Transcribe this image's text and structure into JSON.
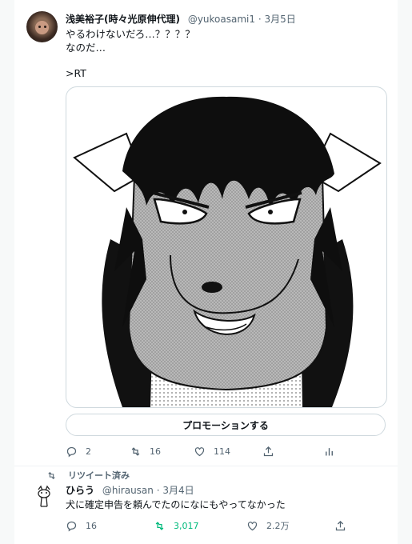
{
  "tweet": {
    "author_name": "浅美裕子(時々光原伸代理)",
    "author_handle": "@yukoasami1",
    "separator": "·",
    "date": "3月5日",
    "text_lines": [
      "やるわけないだろ…？？？？",
      "なのだ…",
      "",
      ">RT"
    ],
    "promote_label": "プロモーションする",
    "reply_count": "2",
    "retweet_count": "16",
    "like_count": "114"
  },
  "retweet": {
    "label": "リツイート済み",
    "author_name": "ひらう",
    "author_handle": "@hirausan",
    "separator": "·",
    "date": "3月4日",
    "text": "犬に確定申告を頼んでたのになにもやってなかった",
    "reply_count": "16",
    "retweet_count": "3,017",
    "like_count": "2.2万"
  },
  "colors": {
    "text": "#0f1419",
    "secondary": "#536471",
    "retweet_active": "#00ba7c",
    "border": "#cfd9de"
  }
}
